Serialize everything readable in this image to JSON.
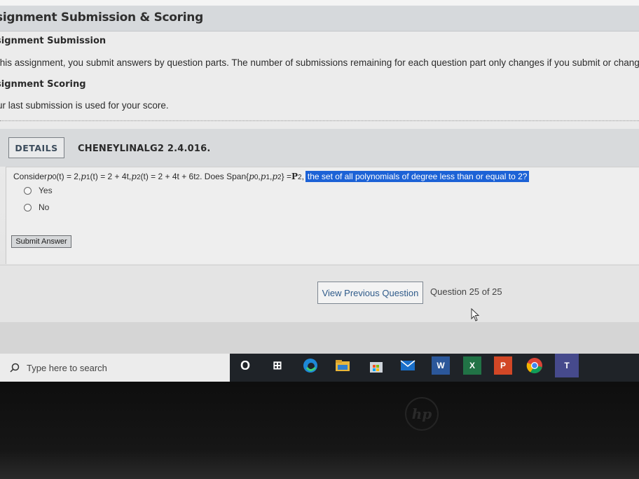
{
  "banner": {
    "title": "signment Submission & Scoring"
  },
  "submission": {
    "heading": "signment Submission",
    "text": "this assignment, you submit answers by question parts. The number of submissions remaining for each question part only changes if you submit or change"
  },
  "scoring": {
    "heading": "signment Scoring",
    "text": "ur last submission is used for your score."
  },
  "question": {
    "details_label": "DETAILS",
    "code": "CHENEYLINALG2 2.4.016.",
    "prompt": {
      "consider": "Consider ",
      "p0": "p",
      "p0_def": "(t) = 2, ",
      "p1_def": "(t) = 2 + 4t, ",
      "p2_def": "(t) = 2 + 4t + 6t",
      "does_span": ". Does Span{",
      "p_sym": "p",
      "sub0": "0",
      "sub1": "1",
      "sub2": "2",
      "sep": ", ",
      "close": "} = ",
      "bold_p": "P",
      "sup2": "2",
      "comma": ",",
      "highlight": "the set of all polynomials of degree less than or equal to 2?"
    },
    "options": [
      "Yes",
      "No"
    ],
    "submit_label": "Submit Answer"
  },
  "nav": {
    "prev_label": "View Previous Question",
    "counter": "Question 25 of 25"
  },
  "taskbar": {
    "search_placeholder": "Type here to search",
    "icons": [
      {
        "name": "cortana-icon",
        "glyph": "O"
      },
      {
        "name": "task-view-icon",
        "glyph": "⊞"
      },
      {
        "name": "edge-icon",
        "glyph": "e"
      },
      {
        "name": "file-explorer-icon",
        "glyph": ""
      },
      {
        "name": "store-icon",
        "glyph": ""
      },
      {
        "name": "mail-icon",
        "glyph": ""
      },
      {
        "name": "word-icon",
        "glyph": "W"
      },
      {
        "name": "excel-icon",
        "glyph": "X"
      },
      {
        "name": "powerpoint-icon",
        "glyph": "P"
      },
      {
        "name": "chrome-icon",
        "glyph": ""
      },
      {
        "name": "teams-icon",
        "glyph": "T"
      }
    ]
  },
  "colors": {
    "highlight": "#1c62d6",
    "link": "#2f5b8a",
    "taskbar": "#1f2328"
  }
}
